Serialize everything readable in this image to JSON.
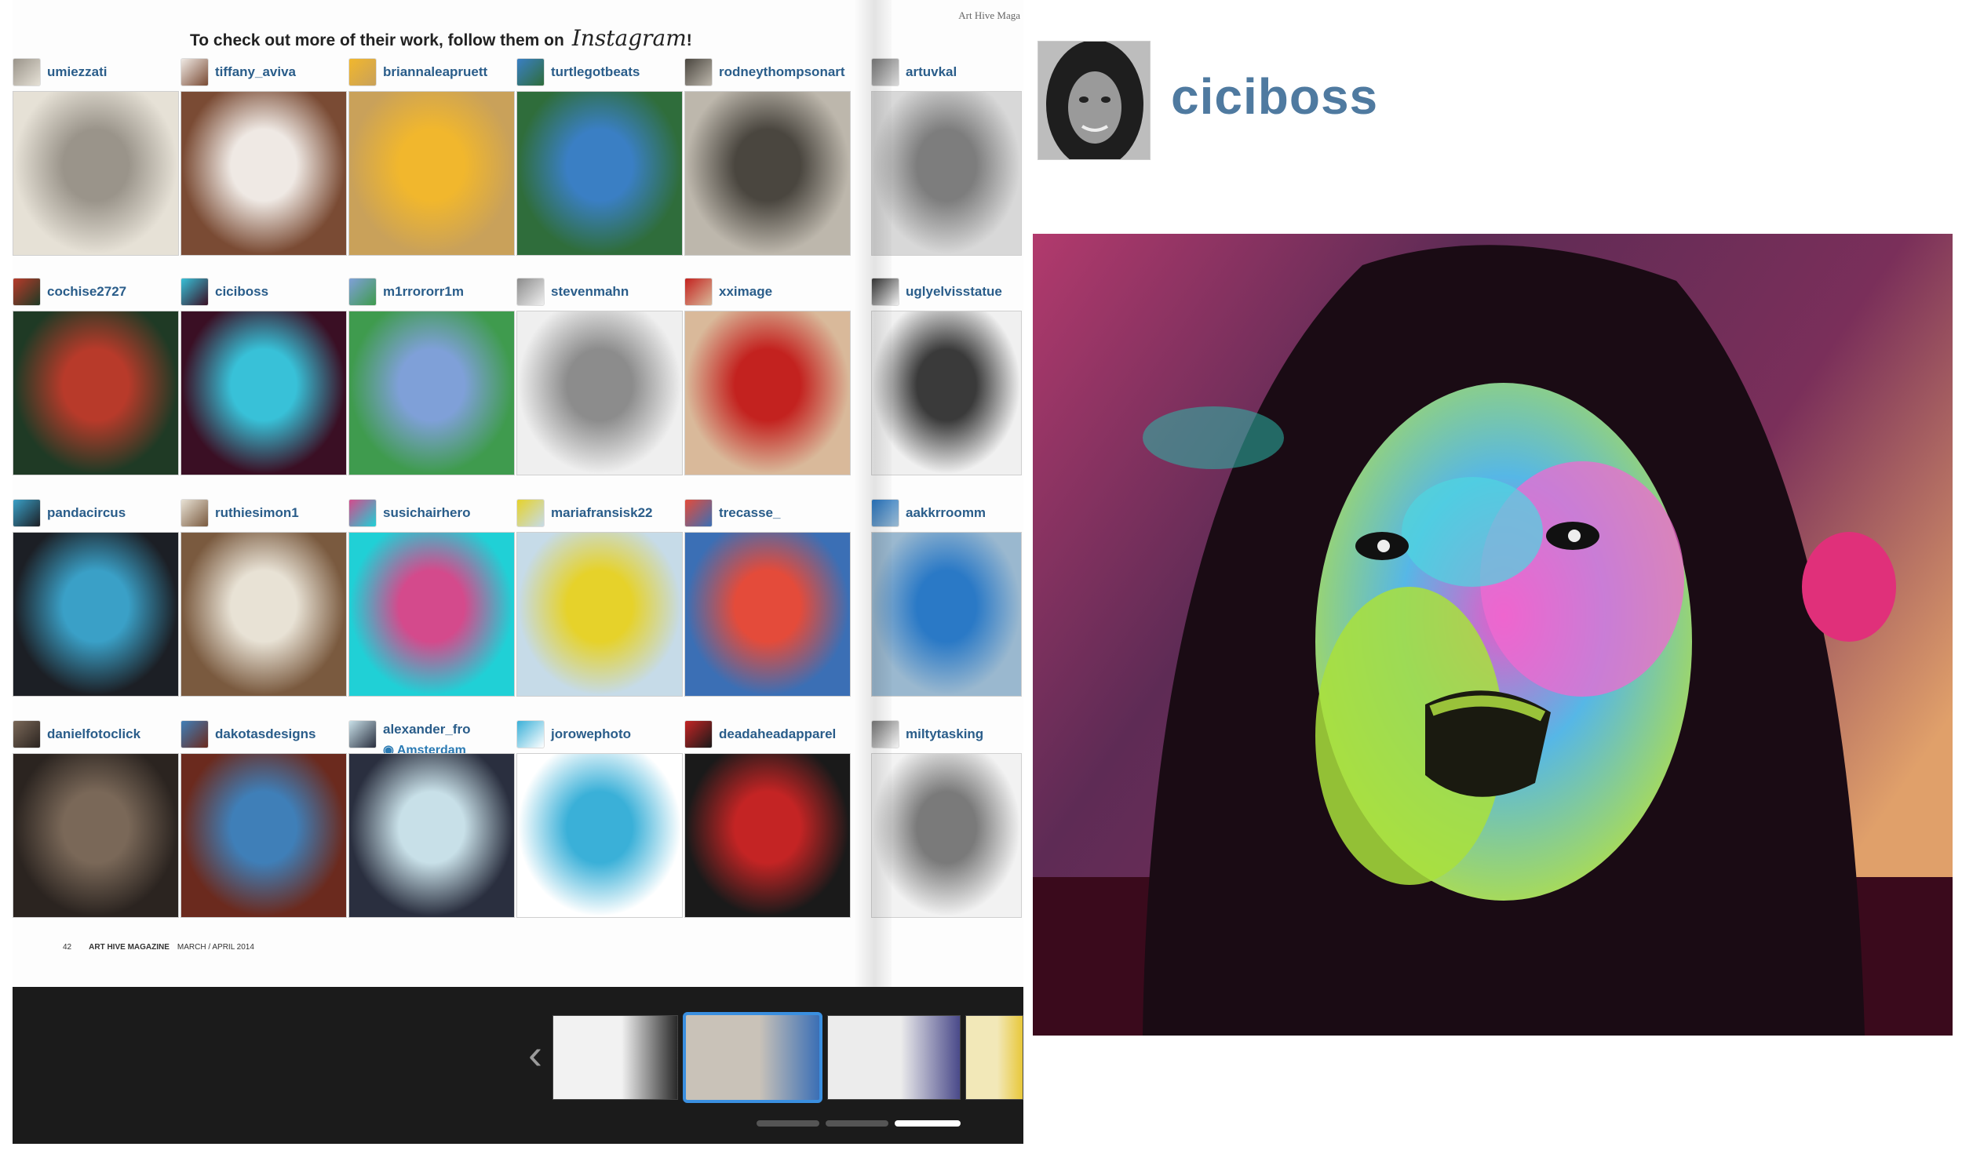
{
  "magazine": {
    "running_head": "Art Hive Maga",
    "follow_text": "To check out more of their work, follow them on",
    "follow_brand": "Instagram",
    "follow_suffix": "!",
    "folio_page": "42",
    "folio_title": "ART HIVE MAGAZINE",
    "folio_issue": "MARCH / APRIL 2014",
    "posts": [
      {
        "user": "umiezzati",
        "loc": "",
        "colors": [
          "#e6e1d6",
          "#9a948a"
        ]
      },
      {
        "user": "tiffany_aviva",
        "loc": "",
        "colors": [
          "#7a4b34",
          "#efe9e4"
        ]
      },
      {
        "user": "briannaleapruett",
        "loc": "",
        "colors": [
          "#c9a15a",
          "#f1b72d"
        ]
      },
      {
        "user": "turtlegotbeats",
        "loc": "",
        "colors": [
          "#2f6d3b",
          "#3a7fc4"
        ]
      },
      {
        "user": "rodneythompsonart",
        "loc": "",
        "colors": [
          "#bdb7ac",
          "#4a463f"
        ]
      },
      {
        "user": "artuvkal",
        "loc": "",
        "colors": [
          "#d8d8d8",
          "#7d7d7d"
        ]
      },
      {
        "user": "cochise2727",
        "loc": "",
        "colors": [
          "#1f3a25",
          "#b83a2a"
        ]
      },
      {
        "user": "ciciboss",
        "loc": "",
        "colors": [
          "#3a0f24",
          "#38c1d8"
        ]
      },
      {
        "user": "m1rrororr1m",
        "loc": "",
        "colors": [
          "#3f9b4e",
          "#7fa0d8"
        ]
      },
      {
        "user": "stevenmahn",
        "loc": "",
        "colors": [
          "#efefef",
          "#8c8c8c"
        ]
      },
      {
        "user": "xximage",
        "loc": "",
        "colors": [
          "#d9b99a",
          "#c3221f"
        ]
      },
      {
        "user": "uglyelvisstatue",
        "loc": "",
        "colors": [
          "#f0f0f0",
          "#3a3a3a"
        ]
      },
      {
        "user": "pandacircus",
        "loc": "",
        "colors": [
          "#1c1f25",
          "#3aa0c7"
        ]
      },
      {
        "user": "ruthiesimon1",
        "loc": "",
        "colors": [
          "#7a5a3f",
          "#e8e2d5"
        ]
      },
      {
        "user": "susichairhero",
        "loc": "",
        "colors": [
          "#20d0d6",
          "#d44a8c"
        ]
      },
      {
        "user": "mariafransisk22",
        "loc": "",
        "colors": [
          "#c6dbe8",
          "#e6d22a"
        ]
      },
      {
        "user": "trecasse_",
        "loc": "",
        "colors": [
          "#3b6fb5",
          "#e44b3a"
        ]
      },
      {
        "user": "aakkrroomm",
        "loc": "",
        "colors": [
          "#9ab8cf",
          "#2a79c6"
        ]
      },
      {
        "user": "danielfotoclick",
        "loc": "",
        "colors": [
          "#2b2420",
          "#7a6858"
        ]
      },
      {
        "user": "dakotasdesigns",
        "loc": "",
        "colors": [
          "#6b2a1e",
          "#3f7fb8"
        ]
      },
      {
        "user": "alexander_fro",
        "loc": "Amsterdam",
        "colors": [
          "#2a2f3f",
          "#c8e0e8"
        ]
      },
      {
        "user": "jorowephoto",
        "loc": "",
        "colors": [
          "#ffffff",
          "#3ab0d8"
        ]
      },
      {
        "user": "deadaheadapparel",
        "loc": "",
        "colors": [
          "#1a1a1a",
          "#c42424"
        ]
      },
      {
        "user": "miltytasking",
        "loc": "",
        "colors": [
          "#f2f2f2",
          "#7a7a7a"
        ]
      }
    ]
  },
  "strip": {
    "prev_label": "‹",
    "thumbs": [
      {
        "name": "page-40-41",
        "colors": [
          "#f2f2f2",
          "#2a2a2a"
        ]
      },
      {
        "name": "page-42-43",
        "colors": [
          "#c9c2b8",
          "#3b6fb5"
        ]
      },
      {
        "name": "page-44-45",
        "colors": [
          "#ececec",
          "#4a4a8a"
        ]
      },
      {
        "name": "page-46",
        "colors": [
          "#f2e8b8",
          "#e8c83a"
        ]
      }
    ]
  },
  "zoom": {
    "username": "ciciboss"
  },
  "icons": {
    "prev": "chevron-left-icon",
    "location": "location-pin-icon"
  }
}
